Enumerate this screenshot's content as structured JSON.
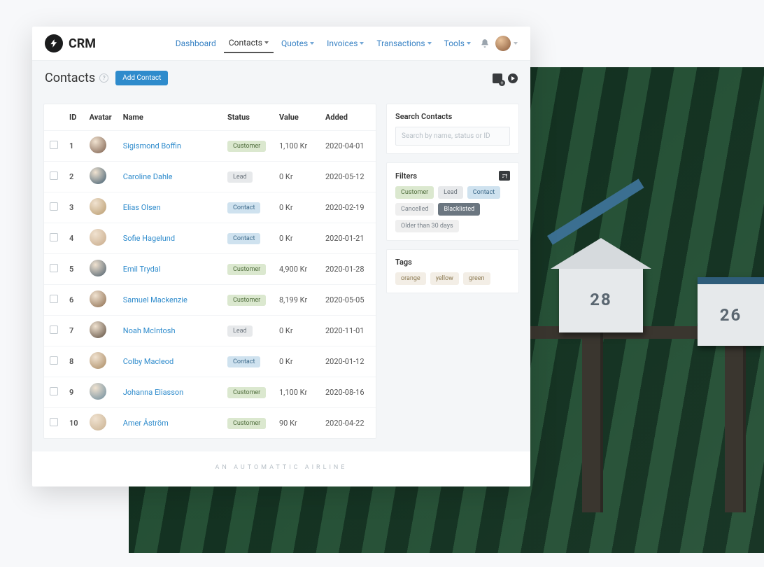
{
  "app": {
    "name": "CRM"
  },
  "nav": {
    "items": [
      {
        "label": "Dashboard",
        "has_caret": false
      },
      {
        "label": "Contacts",
        "has_caret": true,
        "active": true
      },
      {
        "label": "Quotes",
        "has_caret": true
      },
      {
        "label": "Invoices",
        "has_caret": true
      },
      {
        "label": "Transactions",
        "has_caret": true
      },
      {
        "label": "Tools",
        "has_caret": true
      }
    ]
  },
  "page": {
    "title": "Contacts",
    "add_button": "Add Contact"
  },
  "table": {
    "headers": {
      "id": "ID",
      "avatar": "Avatar",
      "name": "Name",
      "status": "Status",
      "value": "Value",
      "added": "Added"
    },
    "rows": [
      {
        "id": "1",
        "name": "Sigismond Boffin",
        "status": "Customer",
        "value": "1,100 Kr",
        "added": "2020-04-01"
      },
      {
        "id": "2",
        "name": "Caroline Dahle",
        "status": "Lead",
        "value": "0 Kr",
        "added": "2020-05-12"
      },
      {
        "id": "3",
        "name": "Elias Olsen",
        "status": "Contact",
        "value": "0 Kr",
        "added": "2020-02-19"
      },
      {
        "id": "4",
        "name": "Sofie Hagelund",
        "status": "Contact",
        "value": "0 Kr",
        "added": "2020-01-21"
      },
      {
        "id": "5",
        "name": "Emil Trydal",
        "status": "Customer",
        "value": "4,900 Kr",
        "added": "2020-01-28"
      },
      {
        "id": "6",
        "name": "Samuel Mackenzie",
        "status": "Customer",
        "value": "8,199 Kr",
        "added": "2020-05-05"
      },
      {
        "id": "7",
        "name": "Noah McIntosh",
        "status": "Lead",
        "value": "0 Kr",
        "added": "2020-11-01"
      },
      {
        "id": "8",
        "name": "Colby Macleod",
        "status": "Contact",
        "value": "0 Kr",
        "added": "2020-01-12"
      },
      {
        "id": "9",
        "name": "Johanna Eliasson",
        "status": "Customer",
        "value": "1,100 Kr",
        "added": "2020-08-16"
      },
      {
        "id": "10",
        "name": "Amer Åström",
        "status": "Customer",
        "value": "90 Kr",
        "added": "2020-04-22"
      }
    ]
  },
  "sidebar": {
    "search": {
      "title": "Search Contacts",
      "placeholder": "Search by name, status or ID"
    },
    "filters": {
      "title": "Filters",
      "chips": [
        {
          "label": "Customer",
          "cls": "customer"
        },
        {
          "label": "Lead",
          "cls": "lead"
        },
        {
          "label": "Contact",
          "cls": "contact"
        },
        {
          "label": "Cancelled",
          "cls": "cancelled"
        },
        {
          "label": "Blacklisted",
          "cls": "blacklisted"
        },
        {
          "label": "Older than 30 days",
          "cls": "older"
        }
      ]
    },
    "tags": {
      "title": "Tags",
      "chips": [
        {
          "label": "orange",
          "cls": "tag"
        },
        {
          "label": "yellow",
          "cls": "tag"
        },
        {
          "label": "green",
          "cls": "tag"
        }
      ]
    }
  },
  "footer": "AN AUTOMATTIC AIRLINE",
  "bg": {
    "mailbox_left": "28",
    "mailbox_right": "26"
  }
}
